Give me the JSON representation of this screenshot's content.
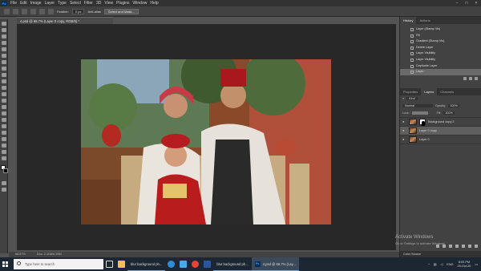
{
  "app_menu": [
    "File",
    "Edit",
    "Image",
    "Layer",
    "Type",
    "Select",
    "Filter",
    "3D",
    "View",
    "Plugins",
    "Window",
    "Help"
  ],
  "options_bar": {
    "feather_label": "Feather:",
    "feather_value": "0 px",
    "anti_alias": "Anti-alias",
    "select_mask": "Select and Mask..."
  },
  "document_tab": "4.psd @ 66.7% (Layer 0 copy, RGB/8) *",
  "status_bar": {
    "zoom": "66.67%",
    "doc": "Doc: 2.11M/6.39M"
  },
  "history": {
    "tabs": [
      "History",
      "Actions"
    ],
    "items": [
      "Layer (Stamp Vis)",
      "Fill",
      "Gradient (Stamp Vis)",
      "Delete Layer",
      "Layer Visibility",
      "Layer Visibility",
      "Duplicate Layer",
      "Layer"
    ],
    "selected_index": 7
  },
  "layers": {
    "tabs": [
      "Properties",
      "Layers",
      "Channels"
    ],
    "kind_label": "Kind",
    "blend_mode": "Normal",
    "opacity_label": "Opacity:",
    "opacity_value": "100%",
    "lock_label": "Lock:",
    "fill_label": "Fill:",
    "fill_value": "100%",
    "rows": [
      {
        "name": "Background copy 2",
        "has_mask": true,
        "selected": false
      },
      {
        "name": "Layer 0 copy",
        "has_mask": false,
        "selected": true
      },
      {
        "name": "Layer 0",
        "has_mask": false,
        "selected": false
      }
    ]
  },
  "color_swatch_label": "Color Source",
  "taskbar": {
    "search_placeholder": "Type here to search",
    "apps": [
      {
        "label": "blur background ph...",
        "active": false
      },
      {
        "label": "blur background ph...",
        "active": false
      },
      {
        "label": "4.psd @ 66.7% (Lay...",
        "active": true
      }
    ],
    "time": "8:03 PM",
    "date": "29-Oct-20",
    "lang": "ENG"
  },
  "watermark": {
    "title": "Activate Windows",
    "sub": "Go to Settings to activate Windows."
  },
  "colors": {
    "accent": "#31a8ff",
    "panel": "#424242",
    "canvas_bg": "#282828"
  }
}
